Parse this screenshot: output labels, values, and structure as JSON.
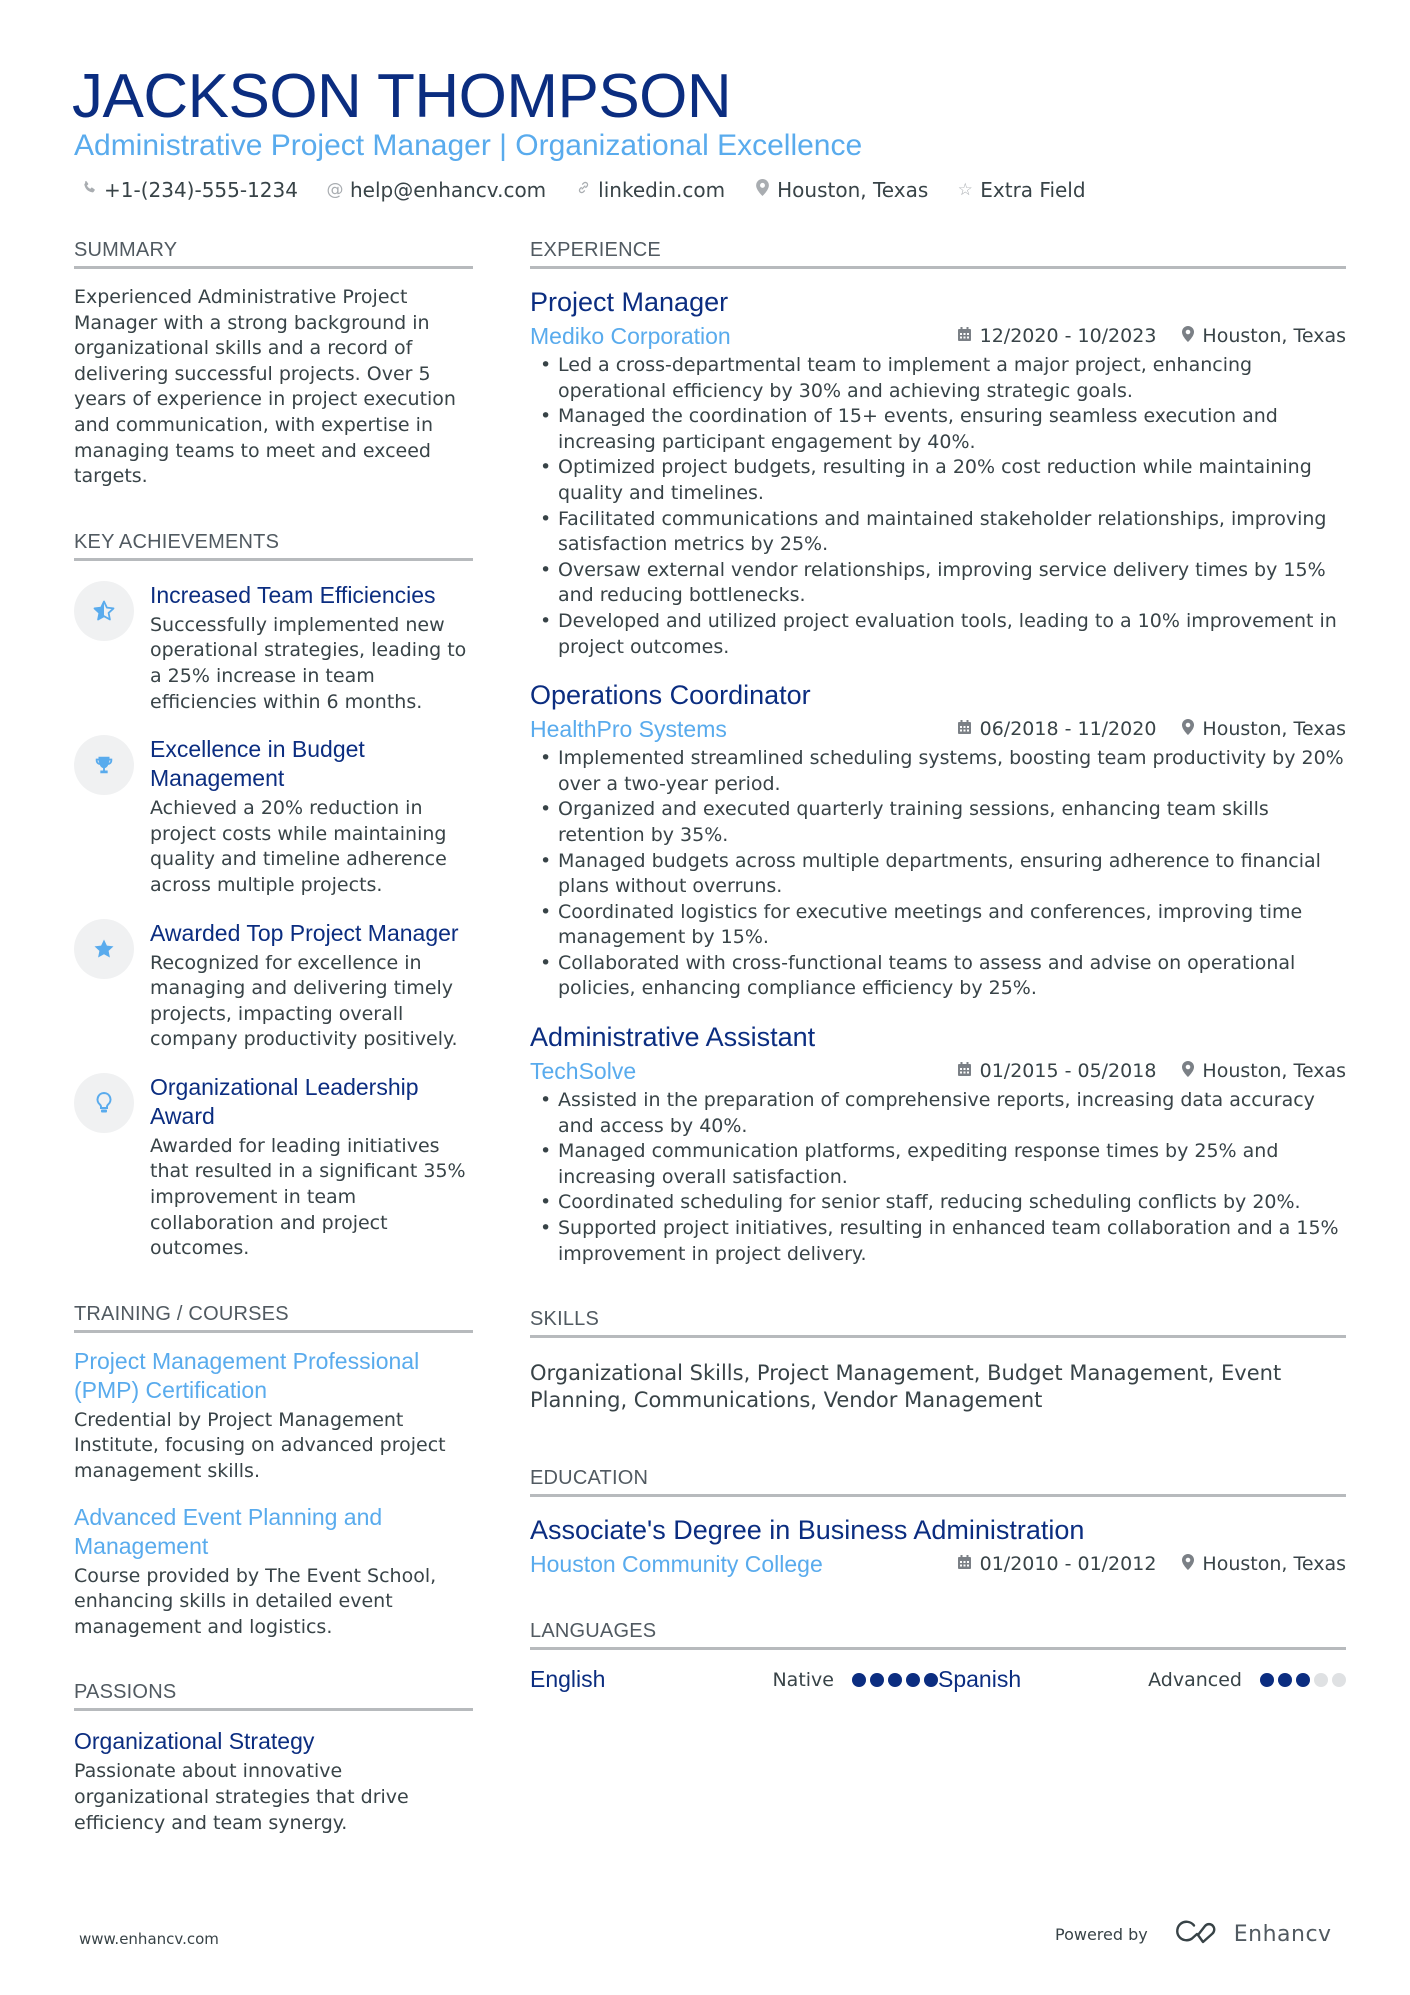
{
  "header": {
    "name": "JACKSON THOMPSON",
    "title": "Administrative Project Manager | Organizational Excellence",
    "contacts": [
      {
        "icon": "phone-icon",
        "glyph": "✆",
        "text": "+1-(234)-555-1234"
      },
      {
        "icon": "at-icon",
        "glyph": "@",
        "text": "help@enhancv.com"
      },
      {
        "icon": "link-icon",
        "glyph": "🔗",
        "text": "linkedin.com"
      },
      {
        "icon": "location-icon",
        "glyph": "⚲",
        "text": "Houston, Texas"
      },
      {
        "icon": "star-outline-icon",
        "glyph": "☆",
        "text": "Extra Field"
      }
    ]
  },
  "summary": {
    "heading": "Summary",
    "text": "Experienced Administrative Project Manager with a strong background in organizational skills and a record of delivering successful projects. Over 5 years of experience in project execution and communication, with expertise in managing teams to meet and exceed targets."
  },
  "achievements": {
    "heading": "Key Achievements",
    "items": [
      {
        "icon": "star-half-icon",
        "title": "Increased Team Efficiencies",
        "desc": "Successfully implemented new operational strategies, leading to a 25% increase in team efficiencies within 6 months."
      },
      {
        "icon": "trophy-icon",
        "title": "Excellence in Budget Management",
        "desc": "Achieved a 20% reduction in project costs while maintaining quality and timeline adherence across multiple projects."
      },
      {
        "icon": "star-icon",
        "title": "Awarded Top Project Manager",
        "desc": "Recognized for excellence in managing and delivering timely projects, impacting overall company productivity positively."
      },
      {
        "icon": "lightbulb-icon",
        "title": "Organizational Leadership Award",
        "desc": "Awarded for leading initiatives that resulted in a significant 35% improvement in team collaboration and project outcomes."
      }
    ]
  },
  "training": {
    "heading": "Training / Courses",
    "items": [
      {
        "title": "Project Management Professional (PMP) Certification",
        "desc": "Credential by Project Management Institute, focusing on advanced project management skills."
      },
      {
        "title": "Advanced Event Planning and Management",
        "desc": "Course provided by The Event School, enhancing skills in detailed event management and logistics."
      }
    ]
  },
  "passions": {
    "heading": "Passions",
    "items": [
      {
        "title": "Organizational Strategy",
        "desc": "Passionate about innovative organizational strategies that drive efficiency and team synergy."
      }
    ]
  },
  "experience": {
    "heading": "Experience",
    "jobs": [
      {
        "title": "Project Manager",
        "company": "Mediko Corporation",
        "dates": "12/2020 - 10/2023",
        "location": "Houston, Texas",
        "bullets": [
          "Led a cross-departmental team to implement a major project, enhancing operational efficiency by 30% and achieving strategic goals.",
          "Managed the coordination of 15+ events, ensuring seamless execution and increasing participant engagement by 40%.",
          "Optimized project budgets, resulting in a 20% cost reduction while maintaining quality and timelines.",
          "Facilitated communications and maintained stakeholder relationships, improving satisfaction metrics by 25%.",
          "Oversaw external vendor relationships, improving service delivery times by 15% and reducing bottlenecks.",
          "Developed and utilized project evaluation tools, leading to a 10% improvement in project outcomes."
        ]
      },
      {
        "title": "Operations Coordinator",
        "company": "HealthPro Systems",
        "dates": "06/2018 - 11/2020",
        "location": "Houston, Texas",
        "bullets": [
          "Implemented streamlined scheduling systems, boosting team productivity by 20% over a two-year period.",
          "Organized and executed quarterly training sessions, enhancing team skills retention by 35%.",
          "Managed budgets across multiple departments, ensuring adherence to financial plans without overruns.",
          "Coordinated logistics for executive meetings and conferences, improving time management by 15%.",
          "Collaborated with cross-functional teams to assess and advise on operational policies, enhancing compliance efficiency by 25%."
        ]
      },
      {
        "title": "Administrative Assistant",
        "company": "TechSolve",
        "dates": "01/2015 - 05/2018",
        "location": "Houston, Texas",
        "bullets": [
          "Assisted in the preparation of comprehensive reports, increasing data accuracy and access by 40%.",
          "Managed communication platforms, expediting response times by 25% and increasing overall satisfaction.",
          "Coordinated scheduling for senior staff, reducing scheduling conflicts by 20%.",
          "Supported project initiatives, resulting in enhanced team collaboration and a 15% improvement in project delivery."
        ]
      }
    ]
  },
  "skills": {
    "heading": "Skills",
    "text": "Organizational Skills, Project Management, Budget Management, Event Planning, Communications, Vendor Management"
  },
  "education": {
    "heading": "Education",
    "items": [
      {
        "degree": "Associate's Degree in Business Administration",
        "school": "Houston Community College",
        "dates": "01/2010 - 01/2012",
        "location": "Houston, Texas"
      }
    ]
  },
  "languages": {
    "heading": "Languages",
    "items": [
      {
        "name": "English",
        "level": "Native",
        "rating": 5,
        "max": 5
      },
      {
        "name": "Spanish",
        "level": "Advanced",
        "rating": 3,
        "max": 5
      }
    ]
  },
  "footer": {
    "website": "www.enhancv.com",
    "powered_by": "Powered by",
    "brand": "Enhancv"
  },
  "colors": {
    "primary": "#0b2d80",
    "accent": "#59abed",
    "text": "#384347",
    "rule": "#b7babd"
  }
}
